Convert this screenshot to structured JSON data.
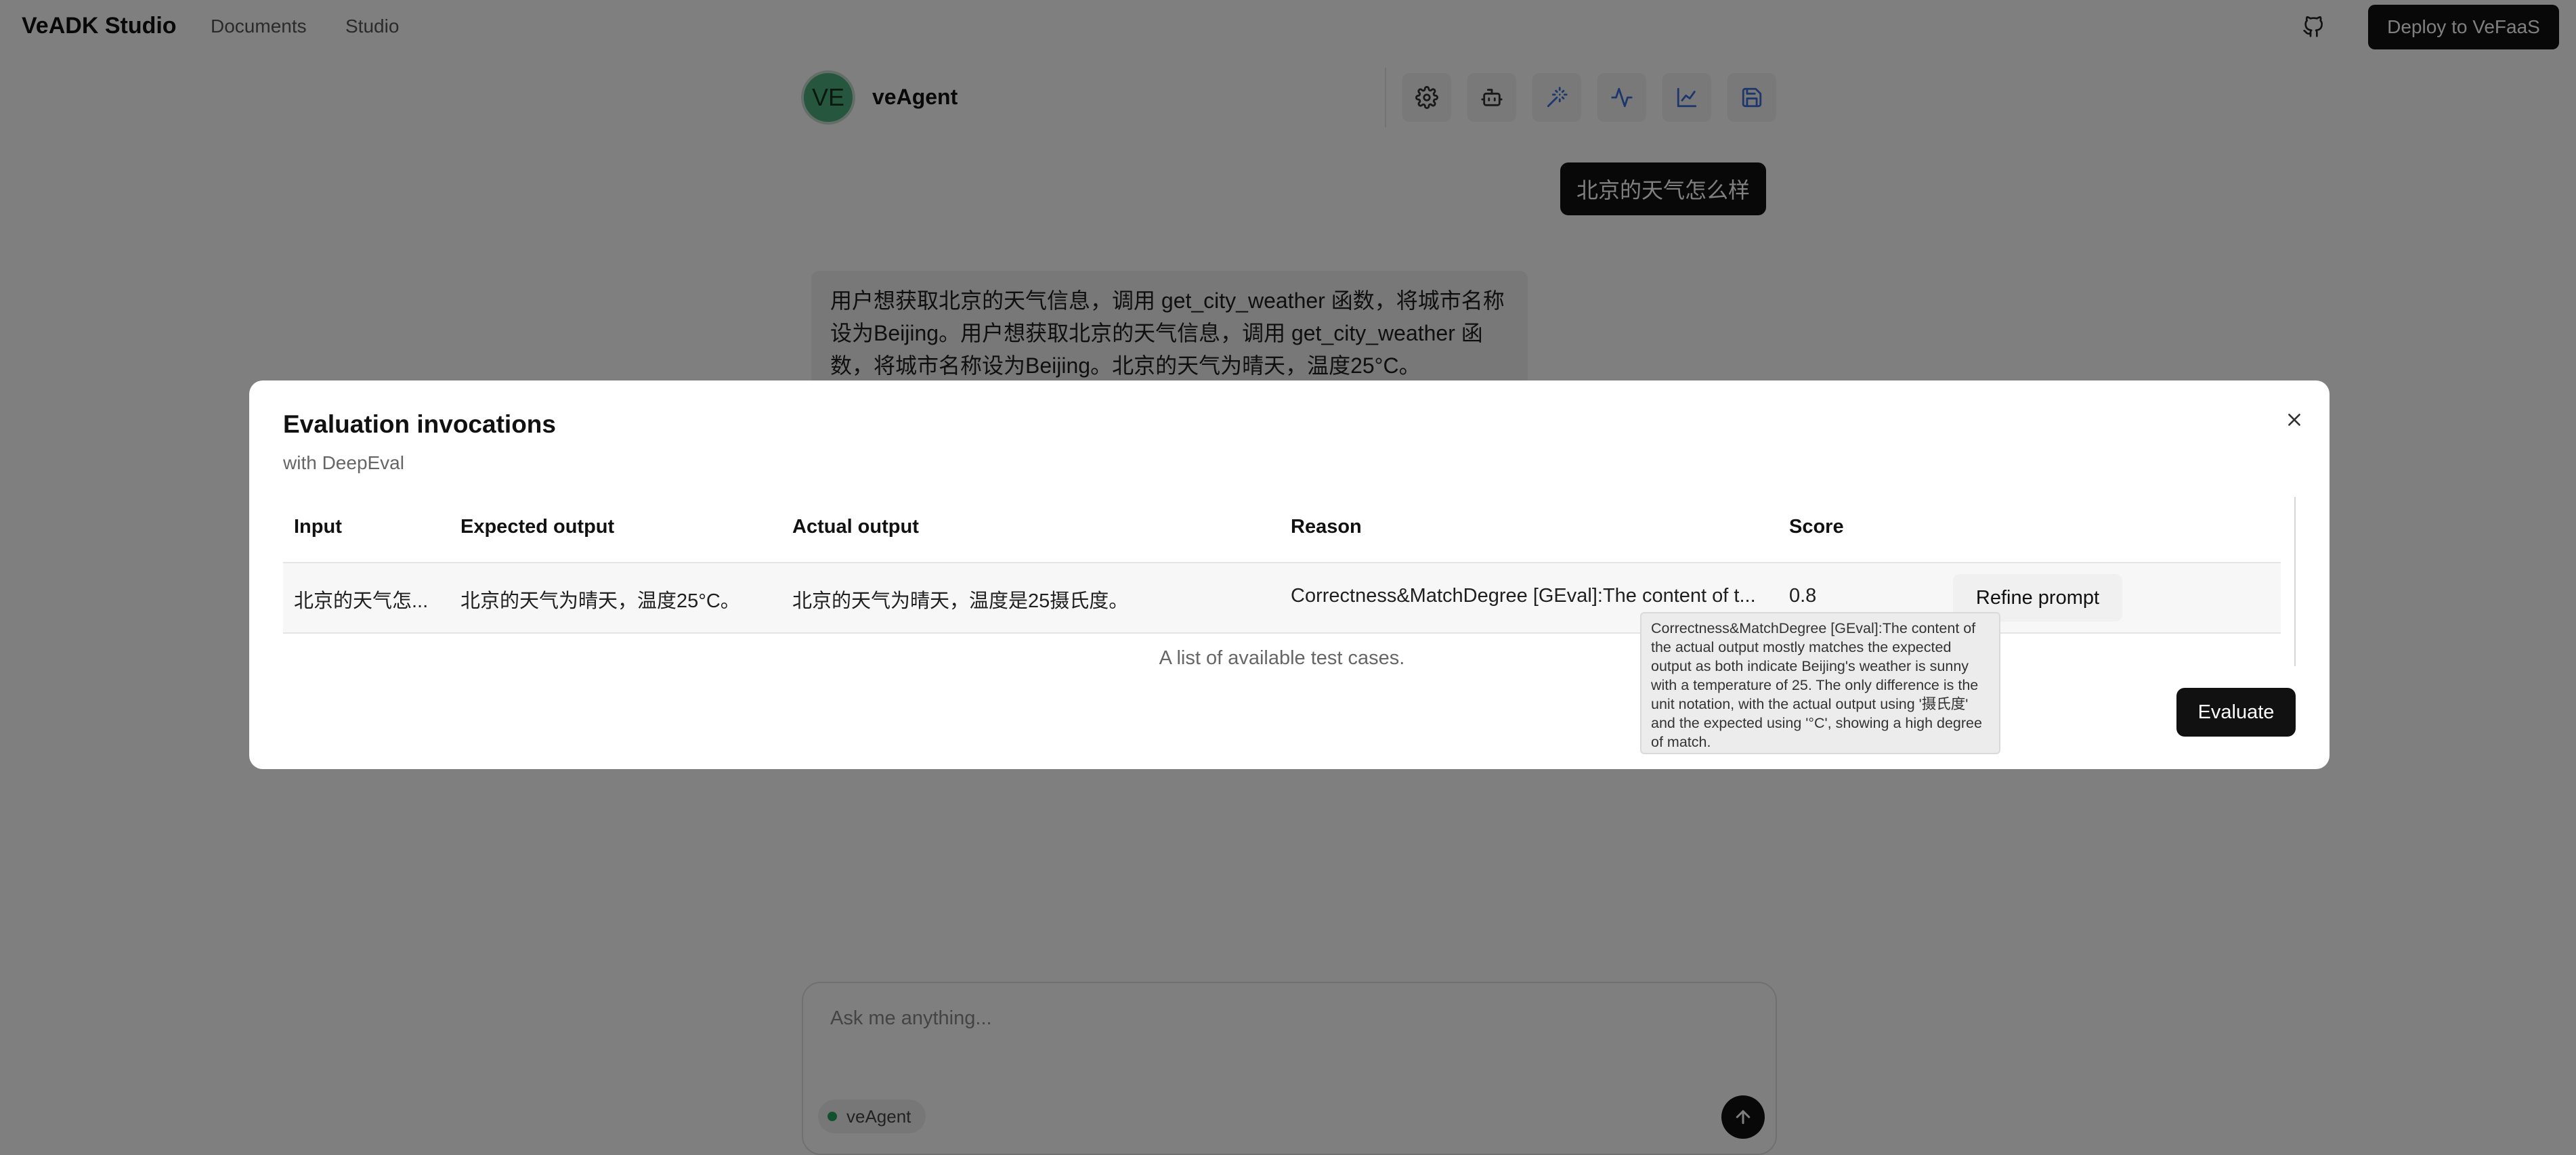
{
  "app": {
    "brand": "VeADK Studio",
    "nav": [
      "Documents",
      "Studio"
    ],
    "deploy_label": "Deploy to VeFaaS"
  },
  "agent": {
    "initials": "VE",
    "name": "veAgent",
    "toolbar_icons": [
      "settings-icon",
      "bot-icon",
      "wand-icon",
      "activity-icon",
      "chart-line-icon",
      "save-icon"
    ],
    "accent_color": "#3b6fd8"
  },
  "chat": {
    "user_message": "北京的天气怎么样",
    "agent_response": "用户想获取北京的天气信息，调用 get_city_weather 函数，将城市名称设为Beijing。用户想获取北京的天气信息，调用 get_city_weather 函数，将城市名称设为Beijing。北京的天气为晴天，温度25°C。"
  },
  "composer": {
    "placeholder": "Ask me anything...",
    "agent_chip": "veAgent",
    "status_color": "#22a35a"
  },
  "dialog": {
    "title": "Evaluation invocations",
    "subtitle": "with DeepEval",
    "columns": [
      "Input",
      "Expected output",
      "Actual output",
      "Reason",
      "Score"
    ],
    "row": {
      "input": "北京的天气怎...",
      "expected": "北京的天气为晴天，温度25°C。",
      "actual": "北京的天气为晴天，温度是25摄氏度。",
      "reason": "Correctness&MatchDegree [GEval]:The content of t...",
      "score": "0.8",
      "action": "Refine prompt"
    },
    "caption": "A list of available test cases.",
    "evaluate_label": "Evaluate",
    "tooltip": "Correctness&MatchDegree [GEval]:The content of the actual output mostly matches the expected output as both indicate Beijing's weather is sunny with a temperature of 25. The only difference is the unit notation, with the actual output using '摄氏度' and the expected using '°C', showing a high degree of match."
  }
}
